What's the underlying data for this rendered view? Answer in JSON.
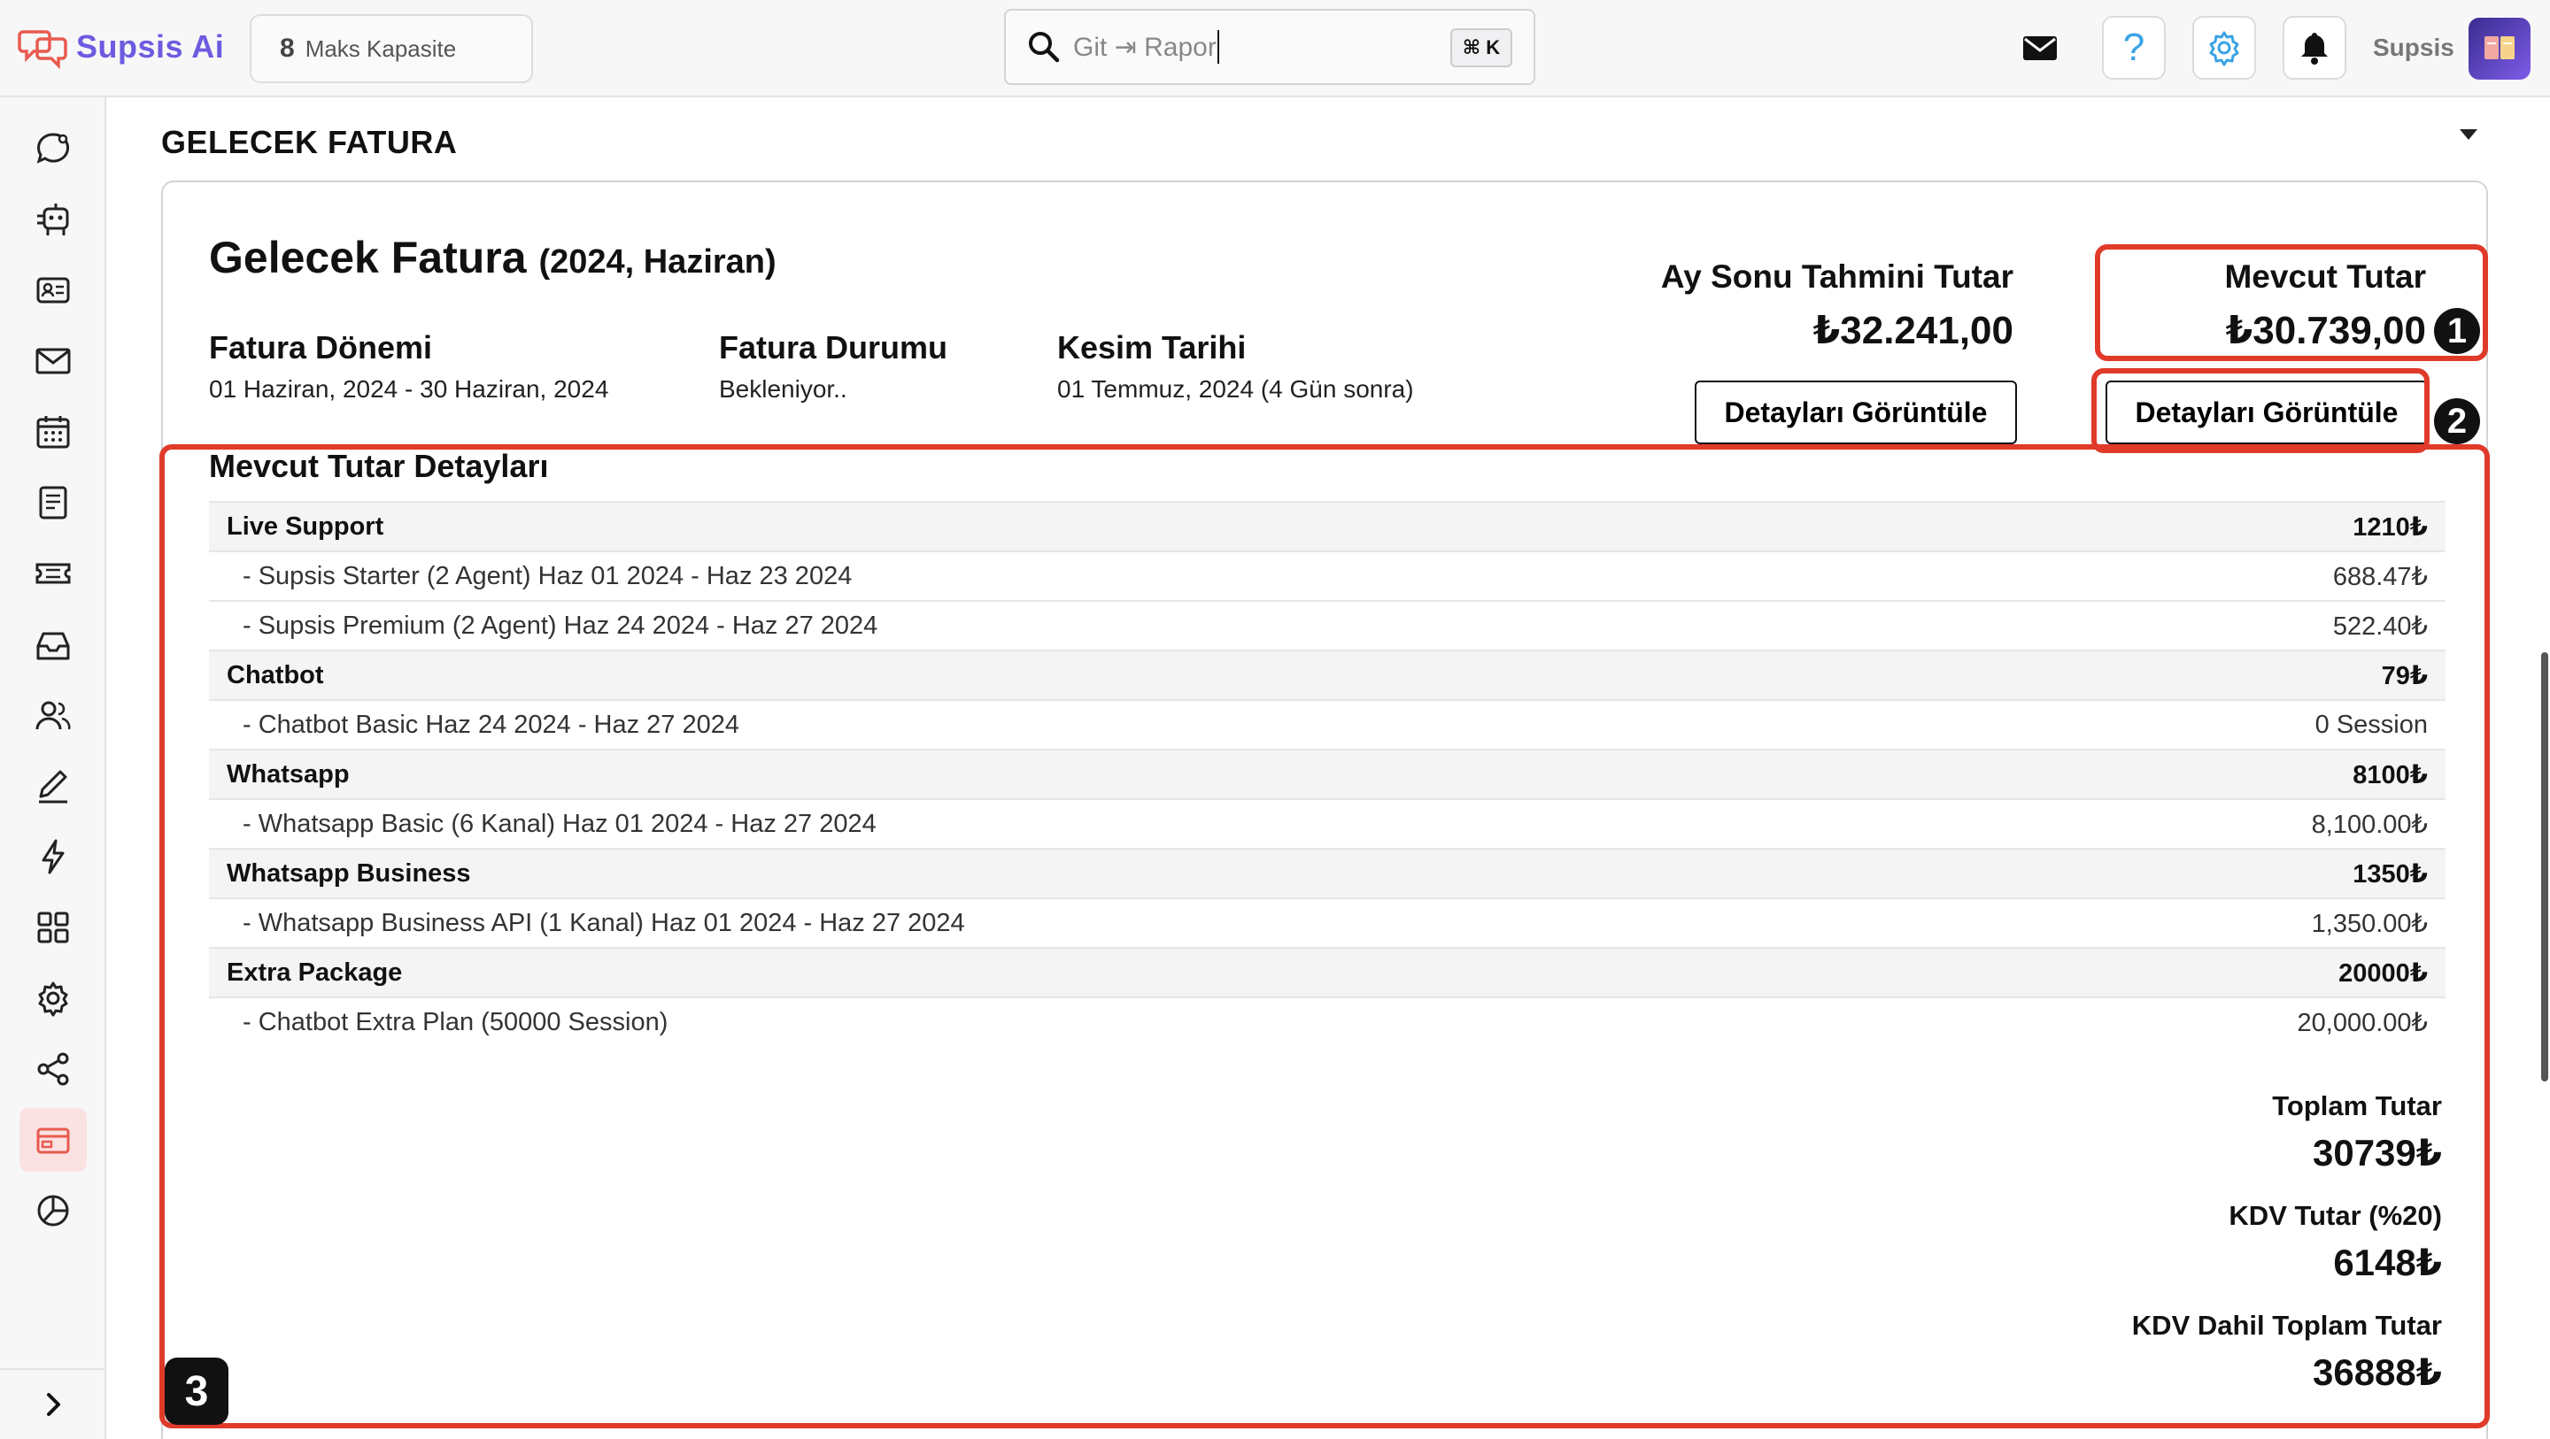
{
  "header": {
    "brand": "Supsis Ai",
    "capacity_count": "8",
    "capacity_label": "Maks Kapasite",
    "search_placeholder": "Git ⇥ Rapor",
    "search_shortcut": "⌘ K",
    "user_name": "Supsis",
    "help_glyph": "?"
  },
  "colors": {
    "brand": "#6d5be0",
    "highlight": "#e03a2a",
    "active_sidebar": "#fbe2e2"
  },
  "sidebar": {
    "items": [
      {
        "icon": "chat-bubble-icon"
      },
      {
        "icon": "bot-icon"
      },
      {
        "icon": "contact-card-icon"
      },
      {
        "icon": "mail-icon"
      },
      {
        "icon": "calendar-icon"
      },
      {
        "icon": "notes-icon"
      },
      {
        "icon": "ticket-icon"
      },
      {
        "icon": "inbox-icon"
      },
      {
        "icon": "users-icon"
      },
      {
        "icon": "pen-icon"
      },
      {
        "icon": "lightning-icon"
      },
      {
        "icon": "apps-grid-icon"
      },
      {
        "icon": "settings-icon"
      },
      {
        "icon": "share-icon"
      },
      {
        "icon": "billing-icon",
        "active": true
      },
      {
        "icon": "pie-chart-icon"
      }
    ],
    "expand_icon": "chevron-right-icon"
  },
  "main": {
    "section_title": "GELECEK FATURA",
    "invoice": {
      "title": "Gelecek Fatura",
      "title_sub": "(2024, Haziran)",
      "period_label": "Fatura Dönemi",
      "period_value": "01 Haziran, 2024 - 30 Haziran, 2024",
      "status_label": "Fatura Durumu",
      "status_value": "Bekleniyor..",
      "cutoff_label": "Kesim Tarihi",
      "cutoff_value": "01 Temmuz, 2024 (4 Gün sonra)",
      "estimate_label": "Ay Sonu Tahmini Tutar",
      "estimate_value": "₺32.241,00",
      "current_label": "Mevcut Tutar",
      "current_value": "₺30.739,00",
      "details_button": "Detayları Görüntüle",
      "details_button_2": "Detayları Görüntüle"
    },
    "details": {
      "title": "Mevcut Tutar Detayları",
      "rows": [
        {
          "type": "cat",
          "name": "Live Support",
          "value": "1210₺"
        },
        {
          "type": "sub",
          "name": "- Supsis Starter (2 Agent) Haz 01 2024 - Haz 23 2024",
          "value": "688.47₺"
        },
        {
          "type": "sub",
          "name": "- Supsis Premium (2 Agent) Haz 24 2024 - Haz 27 2024",
          "value": "522.40₺"
        },
        {
          "type": "cat",
          "name": "Chatbot",
          "value": "79₺"
        },
        {
          "type": "sub",
          "name": "- Chatbot Basic Haz 24 2024 - Haz 27 2024",
          "value": "0 Session"
        },
        {
          "type": "cat",
          "name": "Whatsapp",
          "value": "8100₺"
        },
        {
          "type": "sub",
          "name": "- Whatsapp Basic (6 Kanal) Haz 01 2024 - Haz 27 2024",
          "value": "8,100.00₺"
        },
        {
          "type": "cat",
          "name": "Whatsapp Business",
          "value": "1350₺"
        },
        {
          "type": "sub",
          "name": "- Whatsapp Business API (1 Kanal) Haz 01 2024 - Haz 27 2024",
          "value": "1,350.00₺"
        },
        {
          "type": "cat",
          "name": "Extra Package",
          "value": "20000₺"
        },
        {
          "type": "sub",
          "name": "- Chatbot Extra Plan (50000 Session)",
          "value": "20,000.00₺"
        }
      ],
      "total_label": "Toplam Tutar",
      "total_value": "30739₺",
      "vat_label": "KDV Tutar (%20)",
      "vat_value": "6148₺",
      "grand_label": "KDV Dahil Toplam Tutar",
      "grand_value": "36888₺"
    }
  },
  "annotations": {
    "badge_1": "1",
    "badge_2": "2",
    "badge_3": "3"
  }
}
